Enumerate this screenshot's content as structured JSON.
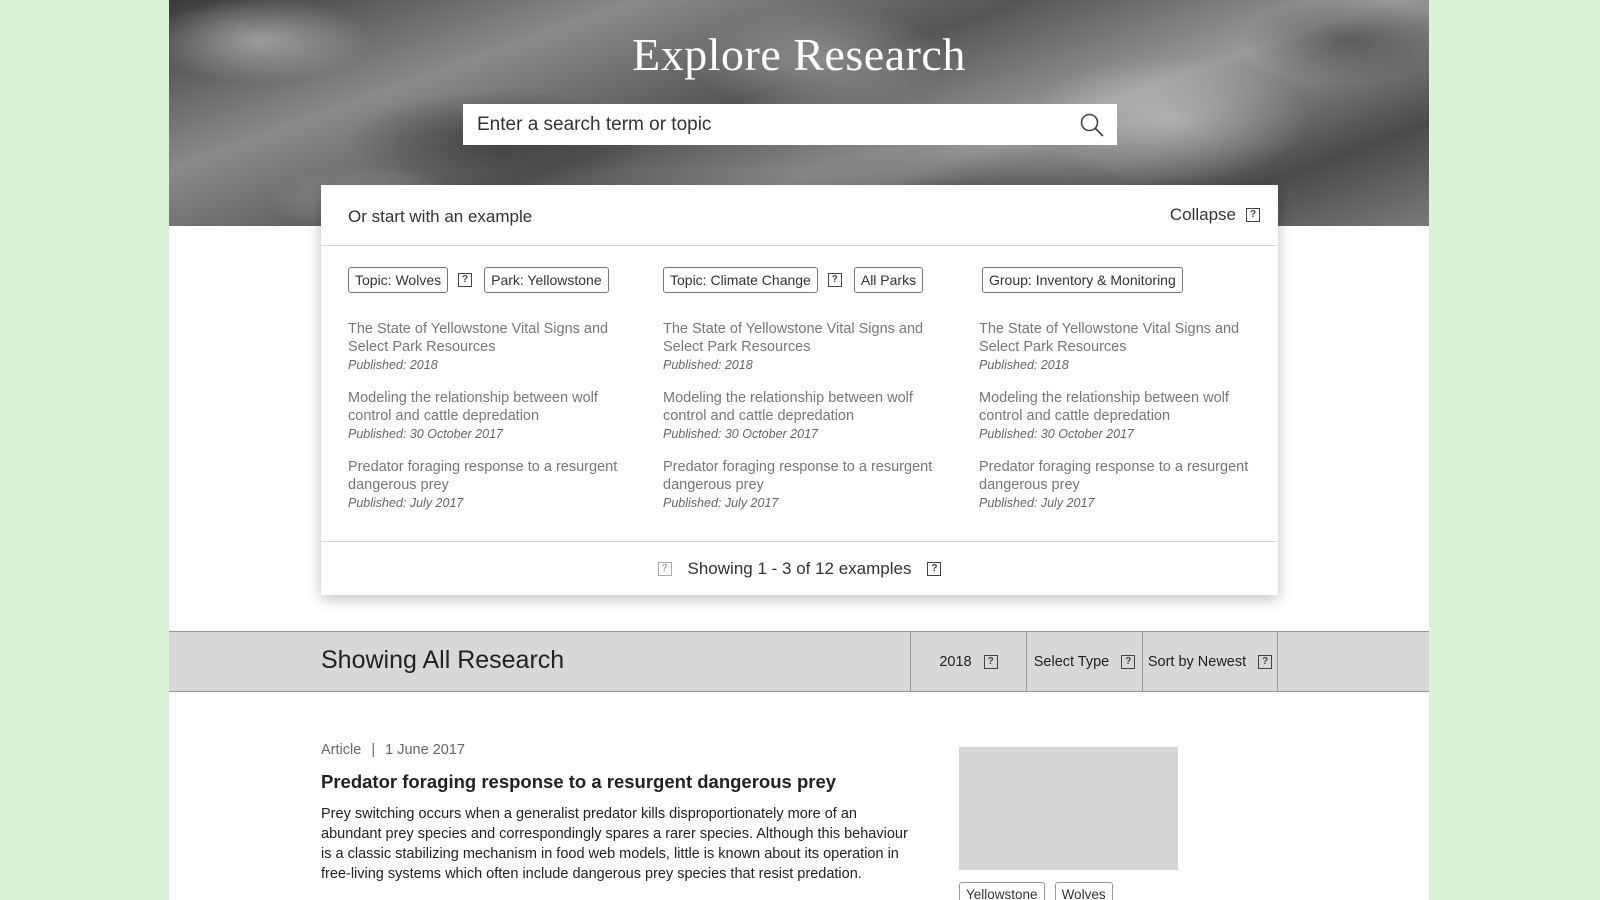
{
  "hero": {
    "title": "Explore Research",
    "search_placeholder": "Enter a search term or topic"
  },
  "examples": {
    "header_label": "Or start with an example",
    "collapse_label": "Collapse",
    "footer_text": "Showing 1 - 3 of 12 examples",
    "columns": [
      {
        "tags": [
          "Topic: Wolves",
          "Park: Yellowstone"
        ],
        "items": [
          {
            "title": "The State of Yellowstone Vital Signs and Select Park Resources",
            "published": "Published: 2018"
          },
          {
            "title": "Modeling the relationship between wolf control and cattle depredation",
            "published": "Published: 30 October 2017"
          },
          {
            "title": "Predator foraging response to a resurgent dangerous prey",
            "published": "Published: July 2017"
          }
        ]
      },
      {
        "tags": [
          "Topic: Climate Change",
          "All Parks"
        ],
        "items": [
          {
            "title": "The State of Yellowstone Vital Signs and Select Park Resources",
            "published": "Published: 2018"
          },
          {
            "title": "Modeling the relationship between wolf control and cattle depredation",
            "published": "Published: 30 October 2017"
          },
          {
            "title": "Predator foraging response to a resurgent dangerous prey",
            "published": "Published: July 2017"
          }
        ]
      },
      {
        "tags": [
          "Group: Inventory & Monitoring"
        ],
        "items": [
          {
            "title": "The State of Yellowstone Vital Signs and Select Park Resources",
            "published": "Published: 2018"
          },
          {
            "title": "Modeling the relationship between wolf control and cattle depredation",
            "published": "Published: 30 October 2017"
          },
          {
            "title": "Predator foraging response to a resurgent dangerous prey",
            "published": "Published: July 2017"
          }
        ]
      }
    ]
  },
  "results_bar": {
    "title": "Showing All Research",
    "year_filter": "2018",
    "type_filter": "Select Type",
    "sort_filter": "Sort by Newest"
  },
  "result": {
    "type": "Article",
    "separator": "|",
    "date": "1 June 2017",
    "title": "Predator foraging response to a resurgent dangerous prey",
    "body": "Prey switching occurs when a generalist predator kills disproportionately more of an abundant prey species and correspondingly spares a rarer species. Although this behaviour is a classic stabilizing mechanism in food web models, little is known about its operation in free-living systems which often include dangerous prey species that resist predation.",
    "tags": [
      "Yellowstone",
      "Wolves"
    ]
  },
  "icons": {
    "search": "search-icon",
    "help": "help-icon"
  }
}
